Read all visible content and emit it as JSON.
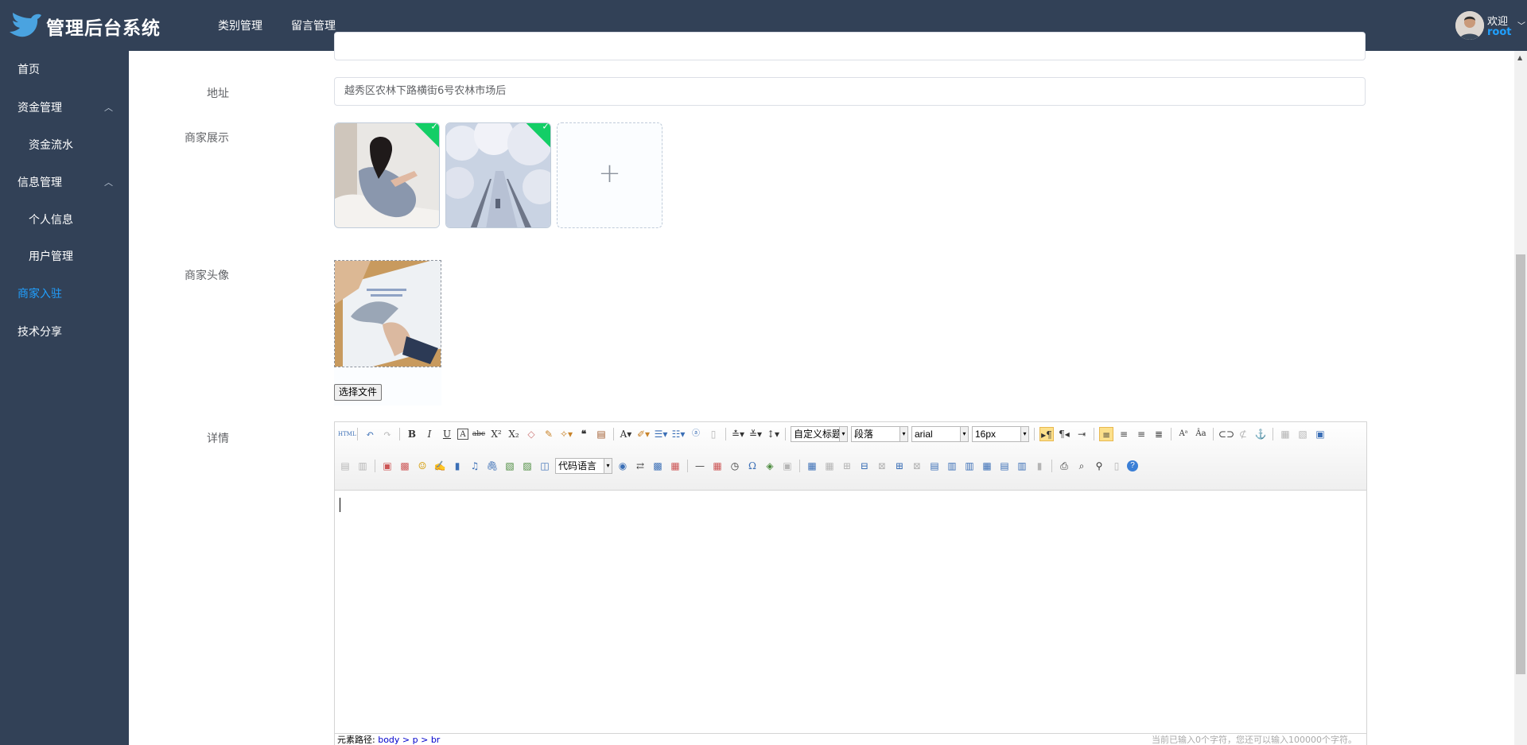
{
  "header": {
    "title": "管理后台系统",
    "nav": [
      "类别管理",
      "留言管理"
    ],
    "user": {
      "welcome": "欢迎",
      "name": "root"
    }
  },
  "sidebar": {
    "items": [
      {
        "label": "首页"
      },
      {
        "label": "资金管理"
      },
      {
        "label": "资金流水"
      },
      {
        "label": "信息管理"
      },
      {
        "label": "个人信息"
      },
      {
        "label": "用户管理"
      },
      {
        "label": "商家入驻"
      },
      {
        "label": "技术分享"
      }
    ]
  },
  "form": {
    "address_label": "地址",
    "address_value": "越秀区农林下路横街6号农林市场后",
    "gallery_label": "商家展示",
    "avatar_label": "商家头像",
    "file_button": "选择文件",
    "detail_label": "详情"
  },
  "editor": {
    "toolbar": {
      "custom_title": "自定义标题",
      "paragraph": "段落",
      "font": "arial",
      "font_size": "16px",
      "code_language": "代码语言"
    },
    "status_path_label": "元素路径:",
    "status_path": "body > p > br",
    "status_count": "当前已输入0个字符，您还可以输入100000个字符。"
  },
  "colors": {
    "header_bg": "#324157",
    "sidebar_bg": "#324157",
    "active": "#20a0ff",
    "success": "#13ce66"
  }
}
